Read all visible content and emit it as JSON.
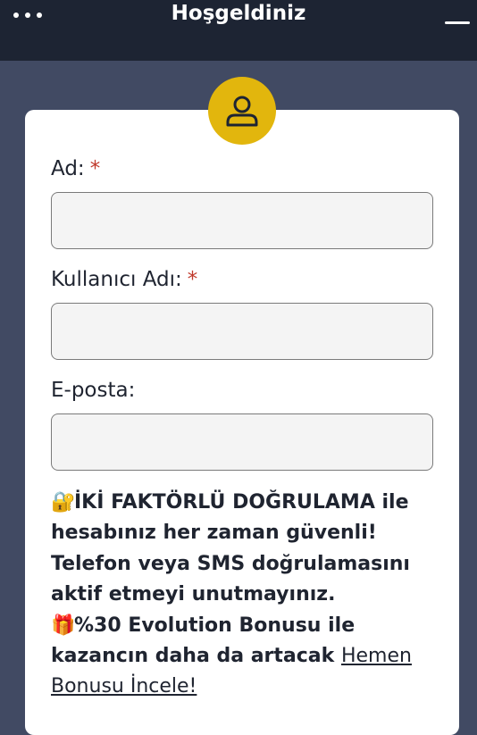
{
  "header": {
    "title": "Hoşgeldiniz"
  },
  "form": {
    "name_label": "Ad:",
    "username_label": "Kullanıcı Adı:",
    "email_label": "E-posta:",
    "required_mark": "*",
    "name_value": "",
    "username_value": "",
    "email_value": ""
  },
  "info": {
    "lock_emoji": "🔐",
    "line1": "İKİ FAKTÖRLÜ DOĞRULAMA ile hesabınız her zaman güvenli! Telefon veya SMS doğrulamasını aktif etmeyi unutmayınız.",
    "gift_emoji": "🎁",
    "line2": "%30 Evolution Bonusu ile kazancın daha da artacak",
    "link": "Hemen Bonusu İncele!"
  },
  "colors": {
    "topbar": "#1d2433",
    "background": "#414a63",
    "avatar": "#e2b60d",
    "required": "#c0392b"
  },
  "icons": {
    "menu": "more-dots-icon",
    "avatar": "user-icon",
    "hamburger": "minimize-icon"
  }
}
